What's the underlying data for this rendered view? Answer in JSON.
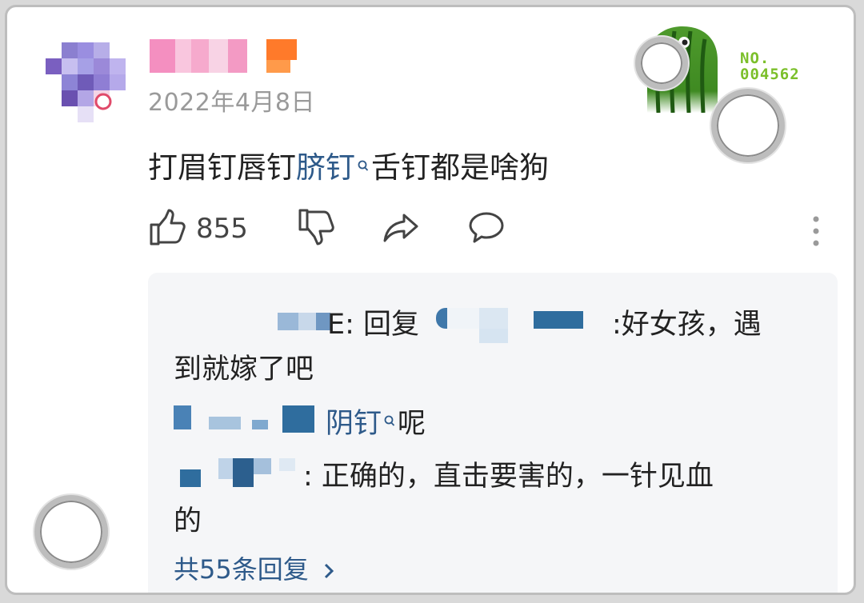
{
  "comment": {
    "date": "2022年4月8日",
    "text_before": "打眉钉唇钉",
    "link_text": "脐钉",
    "text_after": "舌钉都是啥狗",
    "like_count": "855"
  },
  "badge": {
    "number_label": "NO.",
    "number_value": "004562"
  },
  "replies": {
    "reply1": {
      "name_tail": "E",
      "reply_word": ": 回复",
      "content_line1": ":好女孩，遇",
      "content_line2": "到就嫁了吧"
    },
    "reply2": {
      "link_text": "阴钉",
      "tail": "呢"
    },
    "reply3": {
      "content_line1": ": 正确的，直击要害的，一针见血",
      "content_line2": "的"
    },
    "more_label": "共55条回复"
  },
  "colors": {
    "link": "#2e5a8a",
    "badge_green": "#7bbf2a"
  },
  "icons": [
    "thumbs-up-icon",
    "thumbs-down-icon",
    "share-icon",
    "comment-icon",
    "more-vertical-icon",
    "search-mark-icon",
    "chevron-right-icon"
  ]
}
